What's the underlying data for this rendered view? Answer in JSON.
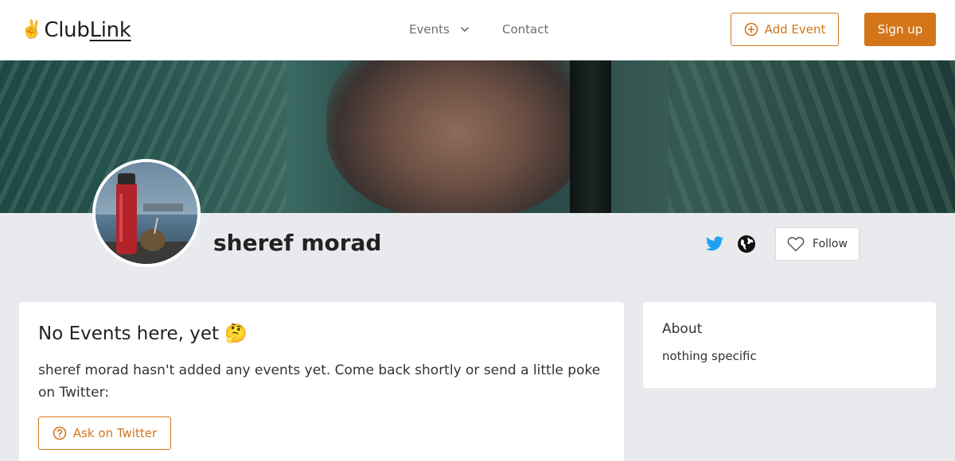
{
  "header": {
    "logo_emoji": "✌️",
    "logo_club": "Club",
    "logo_link": "Link",
    "nav_events": "Events",
    "nav_contact": "Contact",
    "add_event": "Add Event",
    "sign_up": "Sign up"
  },
  "profile": {
    "name": "sheref morad",
    "follow_label": "Follow"
  },
  "events_card": {
    "title": "No Events here, yet 🤔",
    "message": "sheref morad hasn't added any events yet. Come back shortly or send a little poke on Twitter:",
    "ask_button": "Ask on Twitter"
  },
  "about_card": {
    "title": "About",
    "text": "nothing specific"
  },
  "colors": {
    "accent": "#d3761a",
    "twitter": "#1da1f2",
    "page_bg": "#e8eaed"
  },
  "icons": [
    "chevron-down-icon",
    "plus-circle-icon",
    "twitter-icon",
    "globe-icon",
    "heart-icon",
    "question-circle-icon"
  ]
}
